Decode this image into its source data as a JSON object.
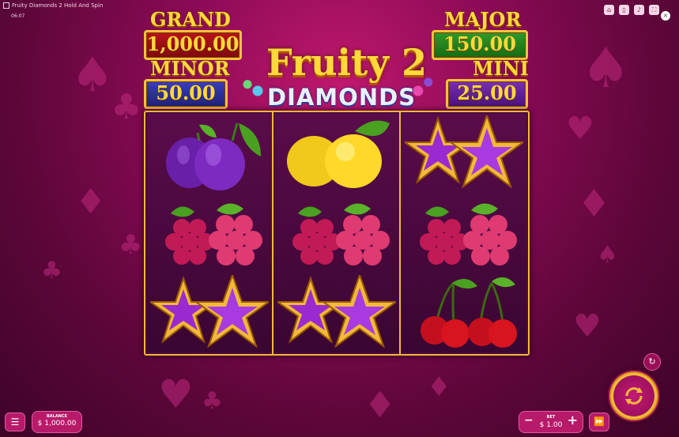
{
  "window": {
    "title": "Fruity Diamonds 2 Hold And Spin",
    "time": "06:07"
  },
  "toolbar": {
    "icons": [
      "home-icon",
      "book-icon",
      "volume-icon",
      "fullscreen-icon"
    ]
  },
  "jackpots": {
    "grand": {
      "label": "GRAND",
      "value": "1,000.00"
    },
    "major": {
      "label": "MAJOR",
      "value": "150.00"
    },
    "minor": {
      "label": "MINOR",
      "value": "50.00"
    },
    "mini": {
      "label": "MINI",
      "value": "25.00"
    }
  },
  "logo": {
    "line1": "Fruity 2",
    "line2": "DIAMONDS"
  },
  "reels": [
    [
      "plum",
      "grapes",
      "star"
    ],
    [
      "lemon",
      "grapes",
      "star"
    ],
    [
      "star",
      "grapes",
      "cherry"
    ]
  ],
  "footer": {
    "balance_label": "BALANCE",
    "balance_value": "$ 1,000.00",
    "bet_label": "BET",
    "bet_value": "$ 1.00",
    "bet_minus": "−",
    "bet_plus": "+"
  },
  "colors": {
    "accent_gold": "#f2b93a",
    "bg": "#8a0a55"
  }
}
